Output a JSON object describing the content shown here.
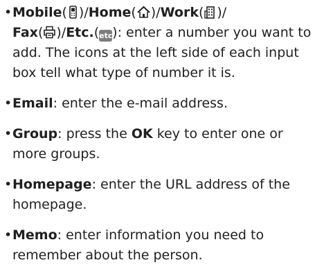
{
  "items": [
    {
      "terms": [
        "Mobile",
        "Home",
        "Work",
        "Fax",
        "Etc."
      ],
      "seps": [
        "(",
        ")/",
        "(",
        ")/",
        "(",
        ")/",
        "(",
        ")/",
        "(",
        ")"
      ],
      "etc_badge": "etc",
      "desc": ": enter a number you want to add. The icons at the left side of each input box tell what type of number it is.",
      "icons": [
        "mobile-phone-icon",
        "home-icon",
        "work-building-icon",
        "fax-icon",
        "etc-icon"
      ]
    },
    {
      "term": "Email",
      "desc": ": enter the e-mail address."
    },
    {
      "term": "Group",
      "pre": ": press the ",
      "key": "OK",
      "desc": " key to enter one or more groups."
    },
    {
      "term": "Homepage",
      "desc": ": enter the URL address of the homepage."
    },
    {
      "term": "Memo",
      "desc": ": enter information you need to remember about the person."
    }
  ],
  "bullet": "•"
}
